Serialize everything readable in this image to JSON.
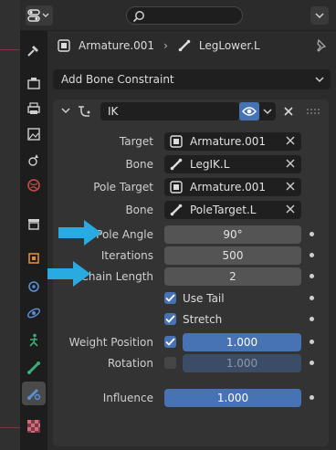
{
  "breadcrumb": {
    "armature": "Armature.001",
    "bone": "LegLower.L"
  },
  "add_constraint": {
    "label": "Add Bone Constraint"
  },
  "constraint": {
    "name": "IK",
    "target_label": "Target",
    "target_value": "Armature.001",
    "bone_label": "Bone",
    "bone_value": "LegIK.L",
    "pole_target_label": "Pole Target",
    "pole_target_value": "Armature.001",
    "pole_bone_label": "Bone",
    "pole_bone_value": "PoleTarget.L",
    "pole_angle_label": "Pole Angle",
    "pole_angle_value": "90°",
    "iterations_label": "Iterations",
    "iterations_value": "500",
    "chain_length_label": "Chain Length",
    "chain_length_value": "2",
    "use_tail_label": "Use Tail",
    "use_tail": true,
    "stretch_label": "Stretch",
    "stretch": true,
    "weight_position_label": "Weight Position",
    "weight_position_enabled": true,
    "weight_position_value": "1.000",
    "rotation_label": "Rotation",
    "rotation_enabled": false,
    "rotation_value": "1.000",
    "influence_label": "Influence",
    "influence_value": "1.000"
  },
  "colors": {
    "accent_blue": "#4772b3",
    "arrow_blue": "#29abe2",
    "panel_bg": "#2b2b2b",
    "field_bg": "#1f1f1f"
  },
  "icons": {
    "editor_type": "properties-editor-icon",
    "search": "search-icon",
    "armature": "armature-data-icon",
    "bone": "bone-icon",
    "pin": "pin-icon",
    "constraint": "ik-constraint-icon",
    "visibility": "eye-icon"
  }
}
